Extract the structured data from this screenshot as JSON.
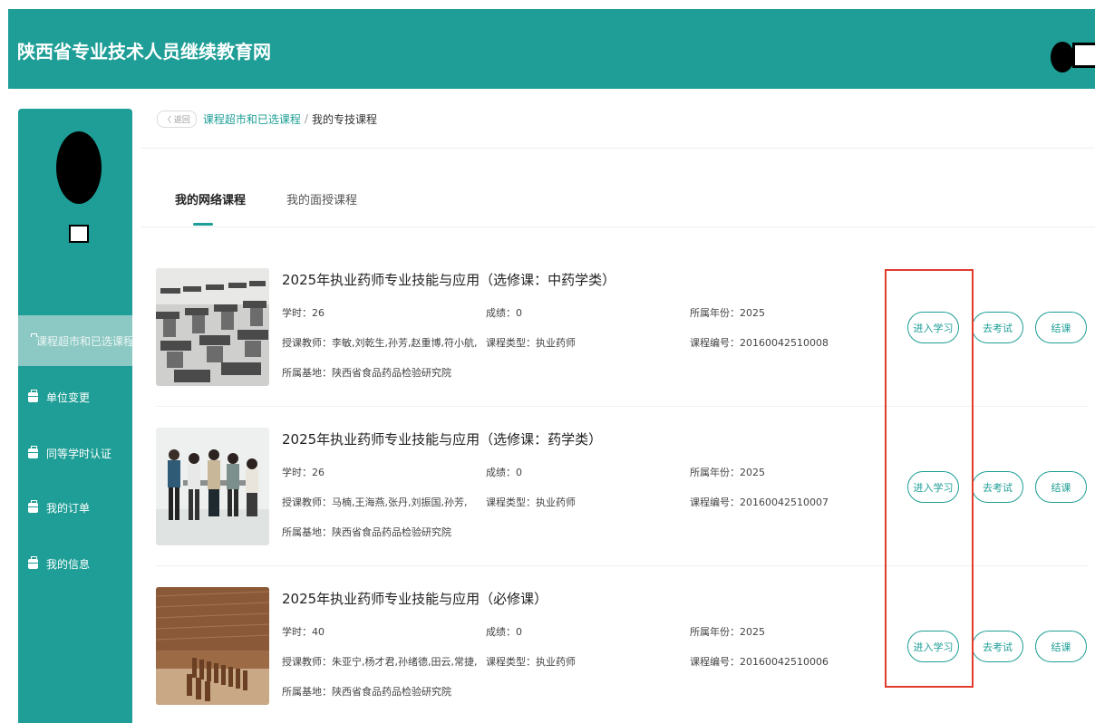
{
  "header": {
    "title": "陕西省专业技术人员继续教育网"
  },
  "sidebar": {
    "items": [
      {
        "label": "课程超市和已选课程",
        "active": true,
        "icon": "briefcase-icon"
      },
      {
        "label": "单位变更",
        "icon": "briefcase-icon"
      },
      {
        "label": "同等学时认证",
        "icon": "briefcase-icon"
      },
      {
        "label": "我的订单",
        "icon": "briefcase-icon"
      },
      {
        "label": "我的信息",
        "icon": "briefcase-icon"
      }
    ]
  },
  "breadcrumb": {
    "back": "〈 返回",
    "parent": "课程超市和已选课程",
    "separator": "/",
    "current": "我的专技课程"
  },
  "tabs": [
    {
      "label": "我的网络课程",
      "active": true
    },
    {
      "label": "我的面授课程"
    }
  ],
  "courses": [
    {
      "title": "2025年执业药师专业技能与应用（选修课：中药学类）",
      "hours": "学时：26",
      "score": "成绩：0",
      "year": "所属年份：2025",
      "teachers": "授课教师：李敏,刘乾生,孙芳,赵重博,符小航,",
      "type": "课程类型：执业药师",
      "code": "课程编号：20160042510008",
      "base": "所属基地：陕西省食品药品检验研究院",
      "image": "classroom-chairs-photo"
    },
    {
      "title": "2025年执业药师专业技能与应用（选修课：药学类）",
      "hours": "学时：26",
      "score": "成绩：0",
      "year": "所属年份：2025",
      "teachers": "授课教师：马楠,王海燕,张丹,刘振国,孙芳,",
      "type": "课程类型：执业药师",
      "code": "课程编号：20160042510007",
      "base": "所属基地：陕西省食品药品检验研究院",
      "image": "team-meeting-photo"
    },
    {
      "title": "2025年执业药师专业技能与应用（必修课）",
      "hours": "学时：40",
      "score": "成绩：0",
      "year": "所属年份：2025",
      "teachers": "授课教师：朱亚宁,杨才君,孙绪德,田云,常捷,",
      "type": "课程类型：执业药师",
      "code": "课程编号：20160042510006",
      "base": "所属基地：陕西省食品药品检验研究院",
      "image": "lecture-hall-photo"
    }
  ],
  "buttons": {
    "study": "进入学习",
    "exam": "去考试",
    "finish": "结课"
  },
  "colors": {
    "brand": "#1e9e96",
    "highlight": "#e23b2e"
  }
}
